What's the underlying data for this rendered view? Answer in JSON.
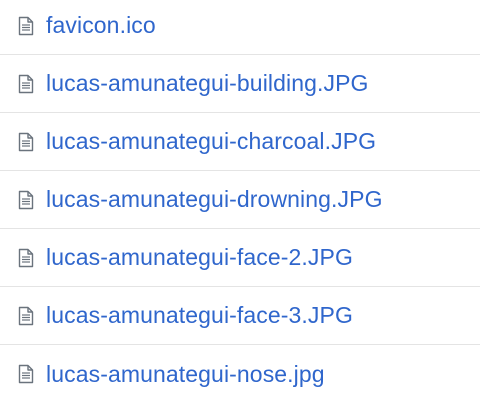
{
  "files": [
    {
      "name": "favicon.ico",
      "icon": "file-icon"
    },
    {
      "name": "lucas-amunategui-building.JPG",
      "icon": "file-icon"
    },
    {
      "name": "lucas-amunategui-charcoal.JPG",
      "icon": "file-icon"
    },
    {
      "name": "lucas-amunategui-drowning.JPG",
      "icon": "file-icon"
    },
    {
      "name": "lucas-amunategui-face-2.JPG",
      "icon": "file-icon"
    },
    {
      "name": "lucas-amunategui-face-3.JPG",
      "icon": "file-icon"
    },
    {
      "name": "lucas-amunategui-nose.jpg",
      "icon": "file-icon"
    }
  ],
  "colors": {
    "link": "#2f66cc",
    "icon": "#6a737d",
    "divider": "#e4e4e4"
  }
}
